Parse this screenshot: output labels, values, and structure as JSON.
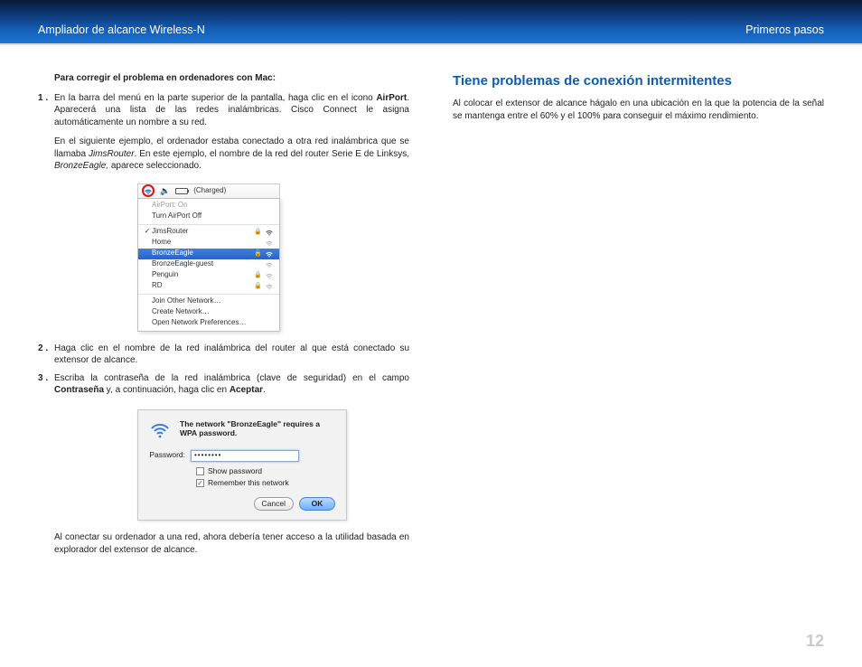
{
  "header": {
    "left": "Ampliador de alcance Wireless-N",
    "right": "Primeros pasos"
  },
  "left": {
    "heading": "Para corregir el problema en ordenadores con Mac:",
    "step1_pre": "En la barra del menú en la parte superior de la pantalla, haga clic en el icono ",
    "step1_b": "AirPort",
    "step1_post": ". Aparecerá una lista de las redes inalámbricas. Cisco Connect le asigna automáticamente un nombre a su red.",
    "para_after1_a": "En el siguiente ejemplo, el ordenador estaba conectado a otra red inalámbrica que se llamaba ",
    "para_after1_i1": "JimsRouter",
    "para_after1_b": ". En este ejemplo, el nombre de la red del router Serie E de Linksys, ",
    "para_after1_i2": "BronzeEagle,",
    "para_after1_c": " aparece seleccionado.",
    "step2": "Haga clic en el nombre de la red inalámbrica del router al que está conectado su extensor de alcance.",
    "step3_a": "Escriba la contraseña de la red inalámbrica (clave de seguridad) en el campo ",
    "step3_b1": "Contraseña",
    "step3_mid": " y, a continuación, haga clic en ",
    "step3_b2": "Aceptar",
    "step3_end": ".",
    "closing": "Al conectar su ordenador a una red, ahora debería tener acceso a la utilidad basada en explorador del extensor de alcance."
  },
  "right": {
    "h2": "Tiene problemas de conexión intermitentes",
    "p": "Al colocar el extensor de alcance hágalo en una ubicación en la que la potencia de la señal se mantenga entre el 60% y el 100% para conseguir el máximo rendimiento."
  },
  "airport": {
    "charged": "(Charged)",
    "status": "AirPort: On",
    "turn_off": "Turn AirPort Off",
    "net_jims": "JimsRouter",
    "net_home": "Home",
    "net_bronze": "BronzeEagle",
    "net_bronze_guest": "BronzeEagle-guest",
    "net_penguin": "Penguin",
    "net_rd": "RD",
    "join": "Join Other Network…",
    "create": "Create Network…",
    "prefs": "Open Network Preferences…"
  },
  "wpa": {
    "msg": "The network \"BronzeEagle\" requires a WPA password.",
    "pw_label": "Password:",
    "pw_value": "••••••••",
    "show": "Show password",
    "remember": "Remember this network",
    "cancel": "Cancel",
    "ok": "OK"
  },
  "page_number": "12"
}
